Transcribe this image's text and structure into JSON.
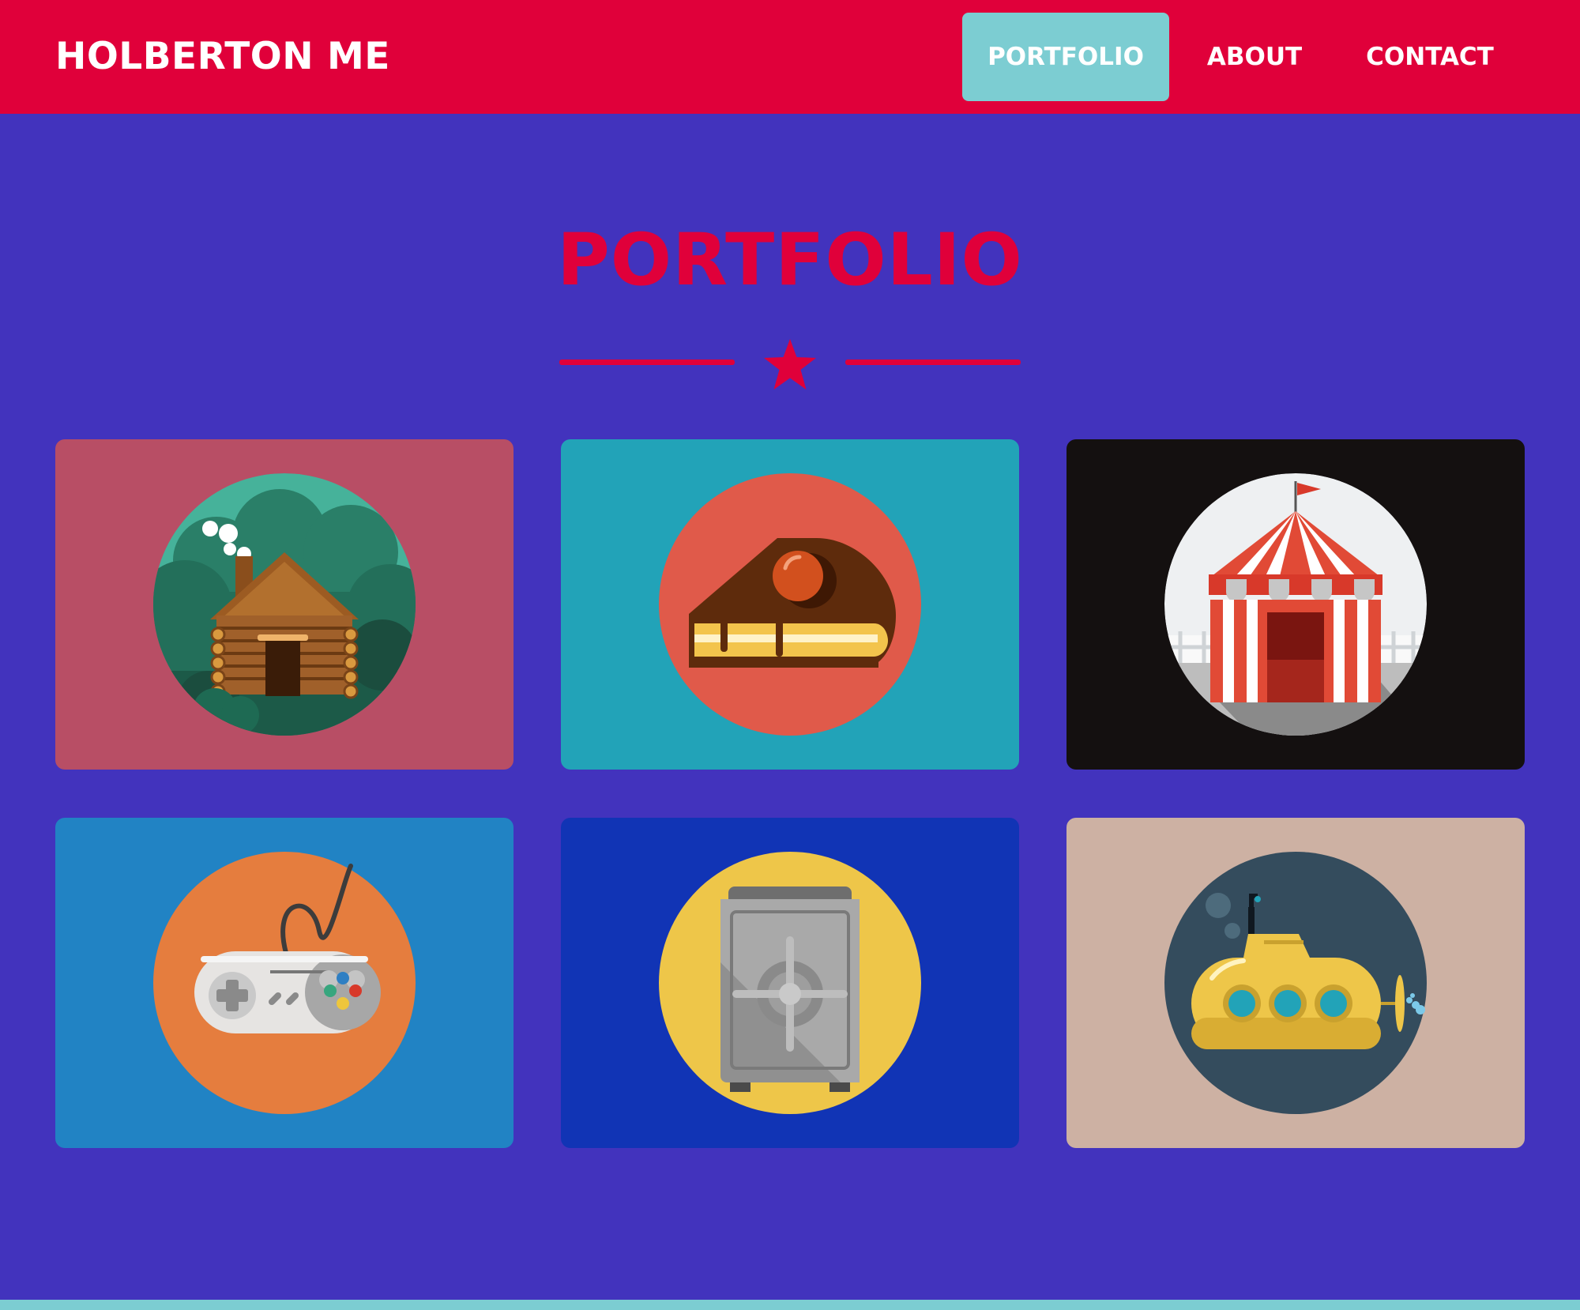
{
  "header": {
    "brand": "HOLBERTON ME",
    "nav": [
      {
        "label": "PORTFOLIO",
        "active": true
      },
      {
        "label": "ABOUT",
        "active": false
      },
      {
        "label": "CONTACT",
        "active": false
      }
    ]
  },
  "main": {
    "title": "PORTFOLIO",
    "divider_icon": "star-icon"
  },
  "portfolio": {
    "items": [
      {
        "icon": "log-cabin-icon",
        "background": "#b84e65",
        "circle": "#2f8f78"
      },
      {
        "icon": "cake-slice-icon",
        "background": "#22a3b8",
        "circle": "#e05a4a"
      },
      {
        "icon": "circus-tent-icon",
        "background": "#141010",
        "circle": "#eef0f2"
      },
      {
        "icon": "gamepad-icon",
        "background": "#2183c4",
        "circle": "#e57d3e"
      },
      {
        "icon": "safe-icon",
        "background": "#1134b5",
        "circle": "#eec649"
      },
      {
        "icon": "submarine-icon",
        "background": "#cdb1a3",
        "circle": "#344c5d"
      }
    ]
  },
  "colors": {
    "navbar": "#e0003a",
    "page_background": "#4233bd",
    "active_nav": "#7ccdd2",
    "accent": "#e0003a"
  }
}
